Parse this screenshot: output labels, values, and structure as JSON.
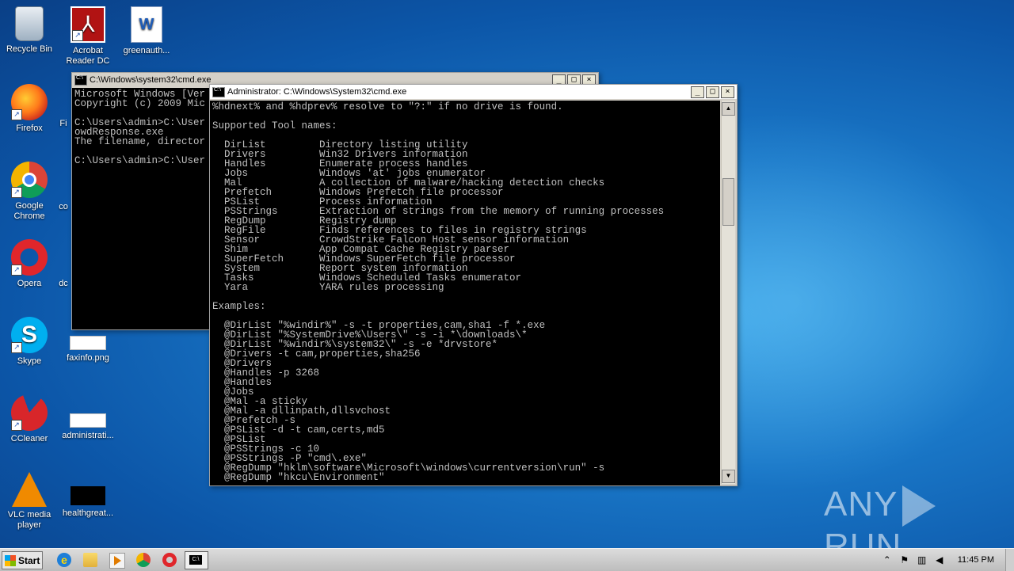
{
  "desktop": {
    "icons": [
      {
        "label": "Recycle Bin"
      },
      {
        "label": "Acrobat Reader DC"
      },
      {
        "label": "greenauth..."
      },
      {
        "label": "Firefox"
      },
      {
        "label": "Fi"
      },
      {
        "label": "Google Chrome"
      },
      {
        "label": "co"
      },
      {
        "label": "Opera"
      },
      {
        "label": "dc"
      },
      {
        "label": "Skype"
      },
      {
        "label": "faxinfo.png"
      },
      {
        "label": "CCleaner"
      },
      {
        "label": "administrati..."
      },
      {
        "label": "VLC media player"
      },
      {
        "label": "healthgreat..."
      }
    ]
  },
  "back_window": {
    "title": "C:\\Windows\\system32\\cmd.exe",
    "lines": [
      "Microsoft Windows [Ver",
      "Copyright (c) 2009 Mic",
      "",
      "C:\\Users\\admin>C:\\User",
      "owdResponse.exe",
      "The filename, director",
      "",
      "C:\\Users\\admin>C:\\User"
    ]
  },
  "front_window": {
    "title": "Administrator: C:\\Windows\\System32\\cmd.exe",
    "lines": [
      "%hdnext% and %hdprev% resolve to \"?:\" if no drive is found.",
      "",
      "Supported Tool names:",
      "",
      "  DirList         Directory listing utility",
      "  Drivers         Win32 Drivers information",
      "  Handles         Enumerate process handles",
      "  Jobs            Windows 'at' jobs enumerator",
      "  Mal             A collection of malware/hacking detection checks",
      "  Prefetch        Windows Prefetch file processor",
      "  PSList          Process information",
      "  PSStrings       Extraction of strings from the memory of running processes",
      "  RegDump         Registry dump",
      "  RegFile         Finds references to files in registry strings",
      "  Sensor          CrowdStrike Falcon Host sensor information",
      "  Shim            App Compat Cache Registry parser",
      "  SuperFetch      Windows SuperFetch file processor",
      "  System          Report system information",
      "  Tasks           Windows Scheduled Tasks enumerator",
      "  Yara            YARA rules processing",
      "",
      "Examples:",
      "",
      "  @DirList \"%windir%\" -s -t properties,cam,sha1 -f *.exe",
      "  @DirList \"%SystemDrive%\\Users\\\" -s -i *\\downloads\\*",
      "  @DirList \"%windir%\\system32\\\" -s -e *drvstore*",
      "  @Drivers -t cam,properties,sha256",
      "  @Drivers",
      "  @Handles -p 3268",
      "  @Handles",
      "  @Jobs",
      "  @Mal -a sticky",
      "  @Mal -a dllinpath,dllsvchost",
      "  @Prefetch -s",
      "  @PSList -d -t cam,certs,md5",
      "  @PSList",
      "  @PSStrings -c 10",
      "  @PSStrings -P \"cmd\\.exe\"",
      "  @RegDump \"hklm\\software\\Microsoft\\windows\\currentversion\\run\" -s",
      "  @RegDump \"hkcu\\Environment\""
    ]
  },
  "watermark": {
    "left": "ANY",
    "right": "RUN"
  },
  "taskbar": {
    "start_label": "Start",
    "clock": "11:45 PM"
  }
}
